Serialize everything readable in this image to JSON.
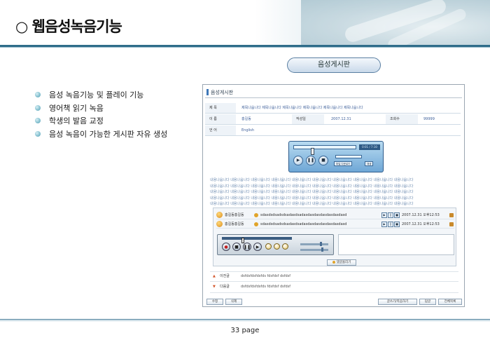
{
  "slide": {
    "title": "○ 웹음성녹음기능",
    "board_label": "음성게시판",
    "bullets": [
      "음성 녹음기능 및 플레이 기능",
      "영어책 읽기 녹음",
      "학생의 발음 교정",
      "음성 녹음이 가능한 게시판 자유 생성"
    ],
    "page_number": "33 page"
  },
  "board": {
    "header": "음성게시판",
    "subject_label": "제   목",
    "subject_value": "제목나옵니다 제목나옵니다 제목나옵니다 제목나옵니다 제목나옵니다 제목나옵니다",
    "name_label": "이   름",
    "name_value": "홍길동",
    "date_label": "작성일",
    "date_value": "2007.12.31",
    "views_label": "조회수",
    "views_value": "99999",
    "category_label": "언   어",
    "category_value": "English",
    "player": {
      "time": "0:01 / 7:10",
      "rec_label": "녹음",
      "btn_a": "파일 다운로드",
      "btn_b": "재생"
    },
    "body_lines": [
      "내용나옵니다 내용나옵니다 내용나옵니다 내용나옵니다 내용나옵니다 내용나옵니다 내용나옵니다 내용나옵니다 내용나옵니다 내용나옵니다",
      "내용나옵니다 내용나옵니다 내용나옵니다 내용나옵니다 내용나옵니다 내용나옵니다 내용나옵니다 내용나옵니다 내용나옵니다 내용나옵니다",
      "내용나옵니다 내용나옵니다 내용나옵니다 내용나옵니다 내용나옵니다 내용나옵니다 내용나옵니다 내용나옵니다 내용나옵니다 내용나옵니다",
      "내용나옵니다 내용나옵니다 내용나옵니다 내용나옵니다 내용나옵니다 내용나옵니다 내용나옵니다 내용나옵니다 내용나옵니다 내용나옵니다",
      "내용나옵니다 내용나옵니다 내용나옵니다 내용나옵니다 내용나옵니다 내용나옵니다 내용나옵니다 내용나옵니다 내용나옵니다 내용나옵니다"
    ],
    "comments": [
      {
        "name": "홍길동홍길동",
        "text": "sdasdsdsadsdsadasdsadasdasdasdasdasdasdasd",
        "date": "2007.12.31 오후12:53"
      },
      {
        "name": "홍길동홍길동",
        "text": "sdasdsdsadsdsadasdsadasdasdasdasdasdasdasd",
        "date": "2007.12.31 오후12:53"
      }
    ],
    "reply_button": "댓글올리기",
    "prev_label": "이전글",
    "prev_text": "dsfdsfdsfdsfds fdsfdsf dsfdsf",
    "next_label": "다음글",
    "next_text": "dsfdsfdsfdsfds fdsfdsf dsfdsf",
    "btn_edit": "수정",
    "btn_delete": "삭제",
    "btn_write": "글쓰기/목음하기",
    "btn_answer": "답글",
    "btn_list": "전체목록"
  },
  "colors": {
    "accent": "#2f6d8a",
    "link": "#3d5f9a",
    "bullet": "#4a9db3"
  }
}
